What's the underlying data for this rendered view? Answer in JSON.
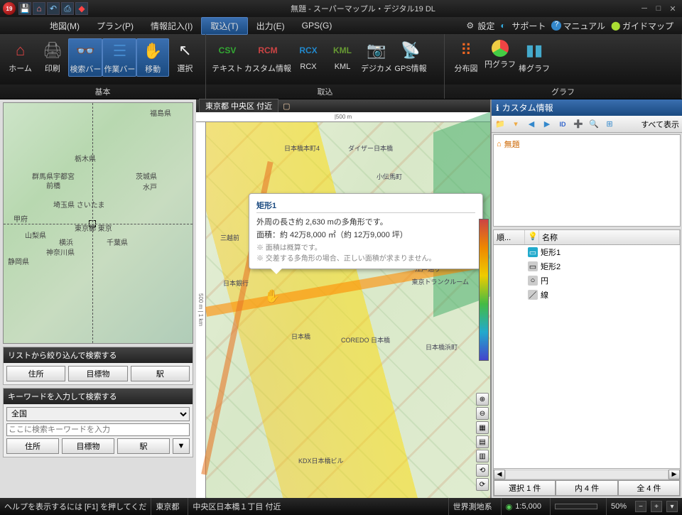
{
  "titlebar": {
    "title": "無題 - スーパーマップル・デジタル19 DL",
    "logo_text": "19"
  },
  "menus": {
    "map": "地図(M)",
    "plan": "プラン(P)",
    "info": "情報記入(I)",
    "import": "取込(T)",
    "export": "出力(E)",
    "gps": "GPS(G)"
  },
  "menu_right": {
    "settings": "設定",
    "support": "サポート",
    "manual": "マニュアル",
    "guidemap": "ガイドマップ"
  },
  "ribbon": {
    "group_basic": "基本",
    "group_import": "取込",
    "group_graph": "グラフ",
    "home": "ホーム",
    "print": "印刷",
    "searchbar": "検索バー",
    "workbar": "作業バー",
    "move": "移動",
    "select": "選択",
    "text": "テキスト",
    "custom": "カスタム情報",
    "rcx": "RCX",
    "kml": "KML",
    "camera": "デジカメ",
    "gpsinfo": "GPS情報",
    "dist": "分布図",
    "pie": "円グラフ",
    "bar": "棒グラフ"
  },
  "minimap_labels": {
    "fukushima": "福島県",
    "tochigi": "栃木県",
    "gunma_u": "群馬県宇都宮",
    "maebashi": "前橋",
    "ibaraki": "茨城県",
    "mito": "水戸",
    "saitama": "埼玉県 さいたま",
    "kofu": "甲府",
    "tokyo": "東京都 東京",
    "yamanashi": "山梨県",
    "yokohama": "横浜",
    "chiba": "千葉県",
    "kanagawa": "神奈川県",
    "shizuoka": "静岡県"
  },
  "search1": {
    "header": "リストから絞り込んで検索する",
    "addr": "住所",
    "landmark": "目標物",
    "station": "駅"
  },
  "search2": {
    "header": "キーワードを入力して検索する",
    "region": "全国",
    "placeholder": "ここに検索キーワードを入力",
    "addr": "住所",
    "landmark": "目標物",
    "station": "駅",
    "more": "▼"
  },
  "maptab": {
    "location": "東京都 中央区 付近"
  },
  "scale_h": "|500 m",
  "scale_v": "500 m | 1 km",
  "tooltip": {
    "title": "矩形1",
    "line1": "外周の長さ約 2,630 mの多角形です。",
    "line2": "面積：約 42万8,000 ㎡（約 12万9,000 坪）",
    "note1": "※ 面積は概算です。",
    "note2": "※ 交差する多角形の場合、正しい面積が求まりません。"
  },
  "map_labels": {
    "l1": "日本橋本町4",
    "l2": "ダイザー日本橋",
    "l3": "小伝馬町",
    "l4": "三越前",
    "l5": "日本銀行",
    "l6": "日本橋",
    "l7": "江戸通り",
    "l8": "東京トランクルーム",
    "l9": "日本橋浜町",
    "l10": "COREDO 日本橋",
    "l11": "KDX日本橋ビル"
  },
  "right": {
    "header": "カスタム情報",
    "show_all": "すべて表示",
    "tree_root": "無題",
    "col_order": "順...",
    "col_name": "名称",
    "items": [
      {
        "name": "矩形1",
        "color": "#2ac"
      },
      {
        "name": "矩形2",
        "color": "#888"
      },
      {
        "name": "円",
        "color": "#888"
      },
      {
        "name": "線",
        "color": "#888"
      }
    ],
    "foot_sel": "選択 1 件",
    "foot_in": "内 4 件",
    "foot_all": "全 4 件"
  },
  "status": {
    "help": "ヘルプを表示するには [F1] を押してくだ",
    "pref": "東京都",
    "addr": "中央区日本橋１丁目 付近",
    "datum": "世界測地系",
    "scale": "1:5,000",
    "zoom": "50%"
  }
}
